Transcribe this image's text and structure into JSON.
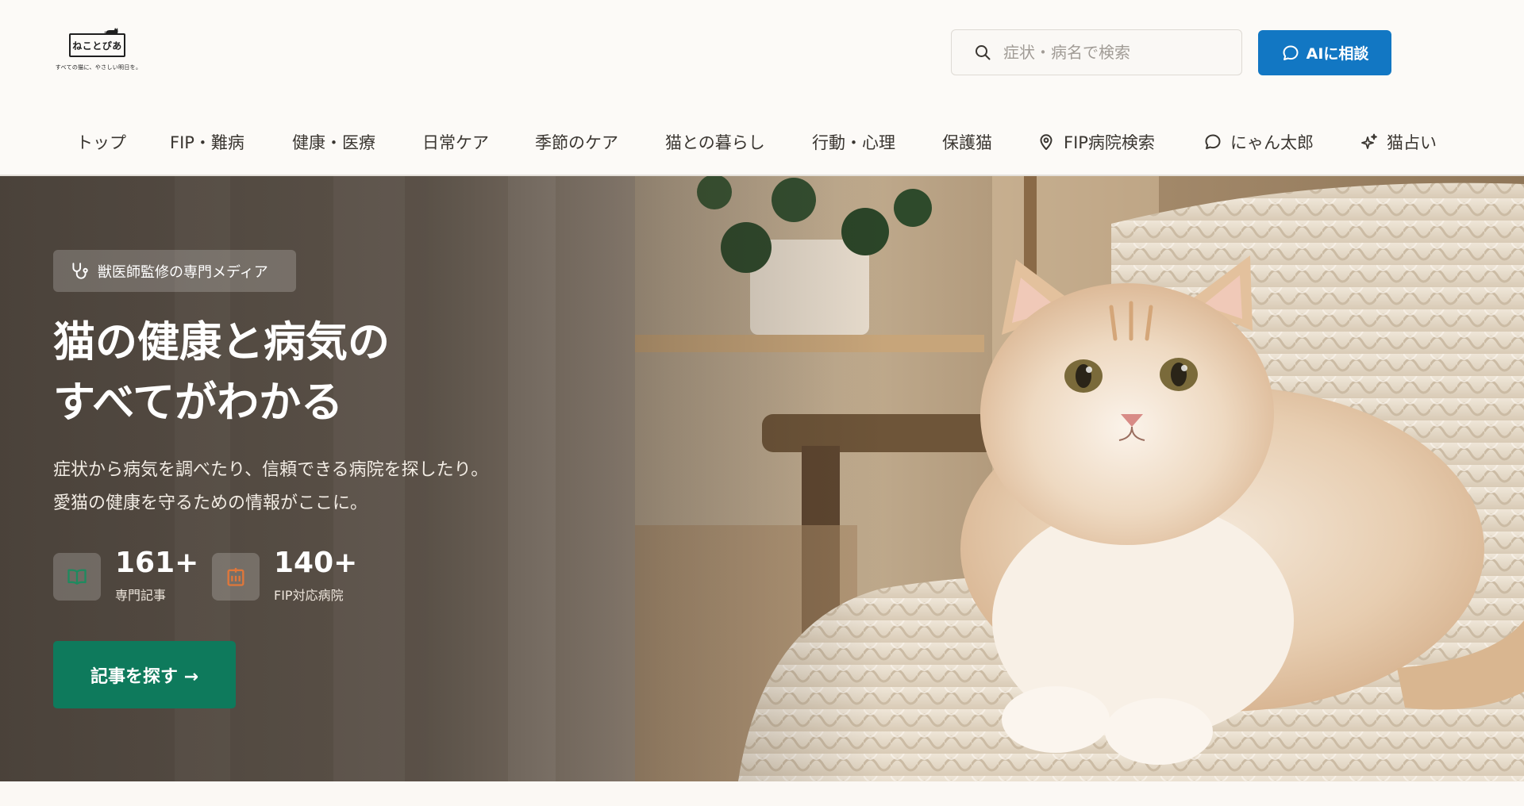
{
  "logo": {
    "name": "ねことぴあ",
    "tagline": "すべての猫に、やさしい明日を。"
  },
  "search": {
    "placeholder": "症状・病名で検索",
    "icon": "search-icon"
  },
  "ai_button": {
    "label": "AIに相談",
    "icon": "chat-bubble-icon"
  },
  "nav": {
    "items": [
      {
        "label": "トップ"
      },
      {
        "label": "FIP・難病"
      },
      {
        "label": "健康・医療"
      },
      {
        "label": "日常ケア"
      },
      {
        "label": "季節のケア"
      },
      {
        "label": "猫との暮らし"
      },
      {
        "label": "行動・心理"
      },
      {
        "label": "保護猫"
      },
      {
        "label": "FIP病院検索",
        "icon": "map-pin-icon"
      },
      {
        "label": "にゃん太郎",
        "icon": "chat-bubble-icon"
      },
      {
        "label": "猫占い",
        "icon": "sparkles-icon"
      }
    ]
  },
  "hero": {
    "badge": "獣医師監修の専門メディア",
    "badge_icon": "stethoscope-icon",
    "title_line1": "猫の健康と病気の",
    "title_line2": "すべてがわかる",
    "text_line1": "症状から病気を調べたり、信頼できる病院を探したり。",
    "text_line2": "愛猫の健康を守るための情報がここに。",
    "stats": [
      {
        "value": "161+",
        "label": "専門記事",
        "icon": "book-open-icon"
      },
      {
        "value": "140+",
        "label": "FIP対応病院",
        "icon": "hospital-icon"
      }
    ],
    "cta": "記事を探す →"
  },
  "colors": {
    "accent_blue": "#1277c3",
    "accent_green": "#0e7a5c",
    "stat_icon_green": "#1f8a5f",
    "stat_icon_orange": "#e0773a",
    "background": "#fcfaf7"
  }
}
